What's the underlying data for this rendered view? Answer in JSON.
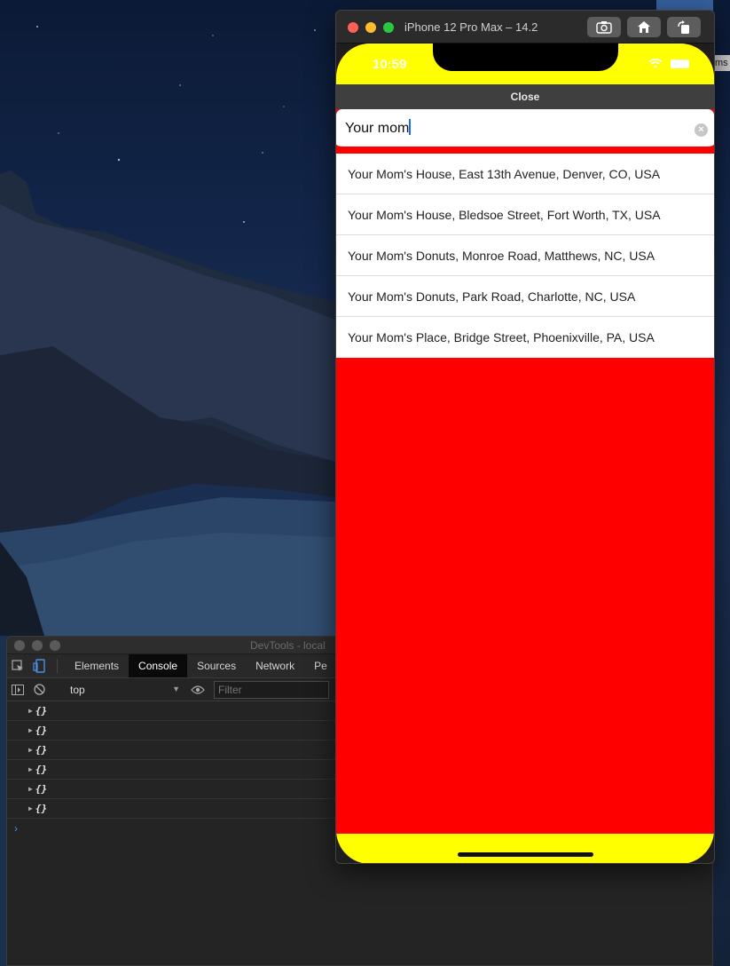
{
  "desktop": {
    "edge_label": "ms"
  },
  "devtools": {
    "title": "DevTools - local",
    "tabs": [
      {
        "label": "Elements",
        "active": false
      },
      {
        "label": "Console",
        "active": true
      },
      {
        "label": "Sources",
        "active": false
      },
      {
        "label": "Network",
        "active": false
      },
      {
        "label": "Pe",
        "active": false
      }
    ],
    "context": "top",
    "filter_placeholder": "Filter",
    "log_entries": [
      "{}",
      "{}",
      "{}",
      "{}",
      "{}",
      "{}"
    ],
    "prompt": "›"
  },
  "simulator": {
    "title": "iPhone 12 Pro Max – 14.2",
    "buttons": [
      "screenshot-icon",
      "home-icon",
      "rotate-icon"
    ],
    "colors": {
      "status_bar": "#ffff00",
      "background": "#ff0000",
      "close_bar": "#3f3f3f",
      "light_red": "#fe5f57",
      "light_yellow": "#febc2e",
      "light_green": "#28c840"
    }
  },
  "phone": {
    "time": "10:59",
    "close_label": "Close",
    "search_value": "Your mom",
    "results": [
      "Your Mom's House, East 13th Avenue, Denver, CO, USA",
      "Your Mom's House, Bledsoe Street, Fort Worth, TX, USA",
      "Your Mom's Donuts, Monroe Road, Matthews, NC, USA",
      "Your Mom's Donuts, Park Road, Charlotte, NC, USA",
      "Your Mom's Place, Bridge Street, Phoenixville, PA, USA"
    ]
  }
}
